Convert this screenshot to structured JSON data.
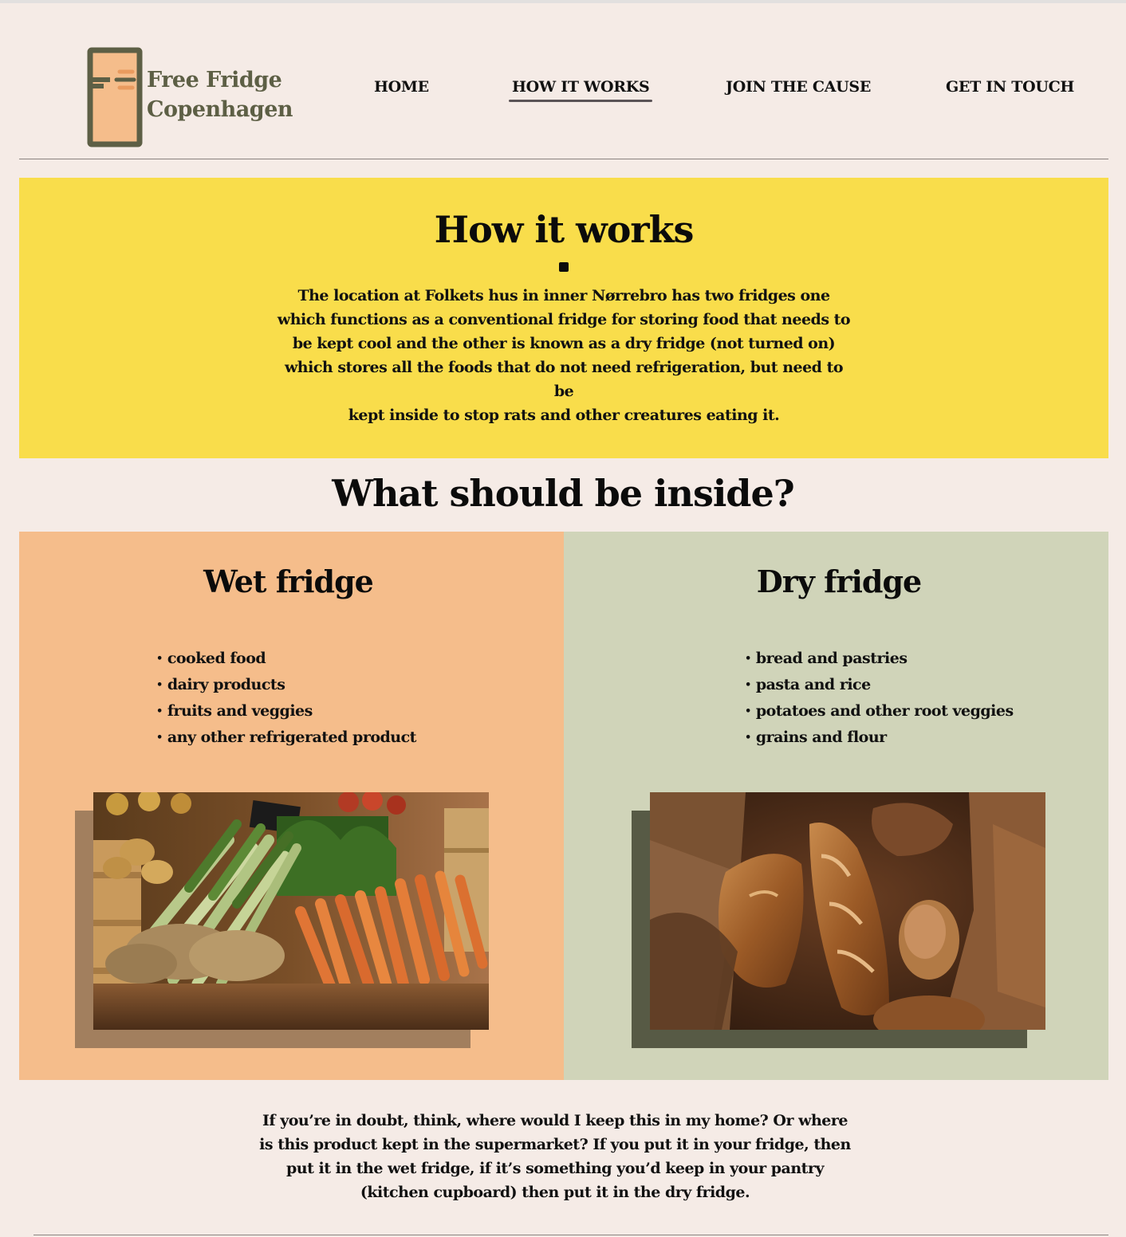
{
  "brand": {
    "name_line1": "Free Fridge",
    "name_line2": "Copenhagen",
    "colors": {
      "logo_green": "#5d5f45",
      "logo_orange": "#f5bd8b",
      "logo_accent": "#e99b5f"
    }
  },
  "nav": {
    "items": [
      {
        "label": "HOME",
        "active": false
      },
      {
        "label": "HOW IT WORKS",
        "active": true
      },
      {
        "label": "JOIN THE CAUSE",
        "active": false
      },
      {
        "label": "GET IN TOUCH",
        "active": false
      }
    ]
  },
  "how_it_works": {
    "title": "How it works",
    "body_lines": [
      "The location at Folkets hus in inner Nørrebro has two fridges one",
      "which functions as a conventional fridge for storing food that needs to",
      "be kept cool and the other is known as a dry fridge (not turned on)",
      "which stores all the foods that do not need refrigeration, but need to be",
      "kept inside to stop rats and other creatures eating it."
    ],
    "background": "#f9dd4b"
  },
  "inside": {
    "title": "What should be inside?",
    "wet": {
      "title": "Wet fridge",
      "items": [
        "cooked food",
        "dairy products",
        "fruits and veggies",
        "any other refrigerated product"
      ],
      "photo": "vegetables-market-photo",
      "background": "#f5bd8b"
    },
    "dry": {
      "title": "Dry fridge",
      "items": [
        "bread and pastries",
        "pasta and rice",
        "potatoes and other root veggies",
        "grains and flour"
      ],
      "photo": "bread-bag-photo",
      "background": "#d0d4b9"
    }
  },
  "doubt_lines": [
    "If you’re in doubt, think, where would I keep this in my home? Or where",
    "is this product kept in the supermarket? If you put it in your fridge, then",
    "put it in the wet fridge, if it’s something you’d keep in your pantry",
    "(kitchen cupboard) then put it in the dry fridge."
  ]
}
